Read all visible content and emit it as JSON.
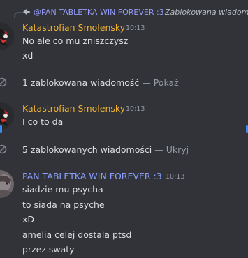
{
  "reply": {
    "author": "@PAN TABLETKA WIN FOREVER :3",
    "preview": "Zablokowana wiadomość"
  },
  "messages": [
    {
      "author": "Katastrofian Smolensky",
      "time": "10:13",
      "lines": [
        "No ale co mu zniszczysz",
        "xd"
      ]
    },
    {
      "author": "Katastrofian Smolensky",
      "time": "10:13",
      "lines": [
        "I co to da"
      ]
    },
    {
      "author": "PAN TABLETKA WIN FOREVER :3",
      "time": "10:13",
      "lines": [
        "siadzie mu psycha",
        "to siada na psyche",
        "xD",
        "amelia celej dostala ptsd",
        "przez swaty"
      ]
    }
  ],
  "blocked": [
    {
      "text": "1 zablokowana wiadomość",
      "separator": "—",
      "action": "Pokaż"
    },
    {
      "text": "5 zablokowanych wiadomości",
      "separator": "—",
      "action": "Ukryj"
    }
  ],
  "colors": {
    "background": "#313338",
    "username_orange": "#f0b232",
    "username_blue": "#8aa0ff",
    "reply_mention": "#949cf7",
    "muted": "#949ba4",
    "selection_marker": "#3a8cf0"
  },
  "icons": {
    "reply": "reply-arrow-icon",
    "blocked": "blocked-icon"
  }
}
